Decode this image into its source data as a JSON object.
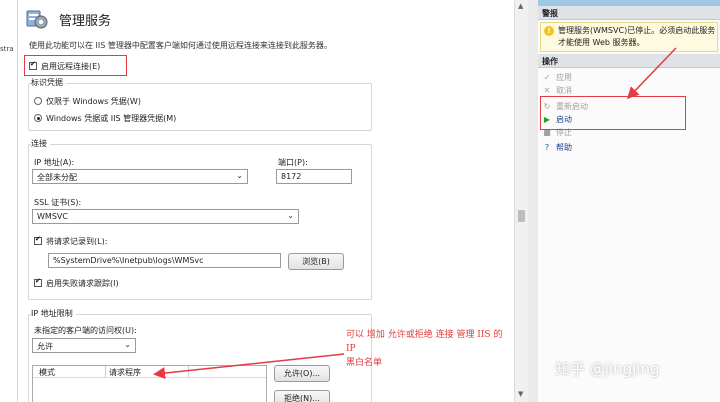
{
  "left_strip": {
    "text": "stra"
  },
  "feature": {
    "title": "管理服务",
    "description": "使用此功能可以在 IIS 管理器中配置客户端如何通过使用远程连接来连接到此服务器。"
  },
  "enable_remote": {
    "label": "启用远程连接(E)",
    "checked": true
  },
  "identity": {
    "group_title": "标识凭据",
    "options": [
      {
        "label": "仅限于 Windows 凭据(W)",
        "checked": false
      },
      {
        "label": "Windows 凭据或 IIS 管理器凭据(M)",
        "checked": true
      }
    ]
  },
  "connection": {
    "group_title": "连接",
    "ip_label": "IP 地址(A):",
    "ip_value": "全部未分配",
    "port_label": "端口(P):",
    "port_value": "8172",
    "ssl_label": "SSL 证书(S):",
    "ssl_value": "WMSVC",
    "log_label": "将请求记录到(L):",
    "log_checked": true,
    "log_path": "%SystemDrive%\\Inetpub\\logs\\WMSvc",
    "browse_label": "浏览(B)",
    "failed_label": "启用失败请求跟踪(I)",
    "failed_checked": true
  },
  "ip_restrictions": {
    "group_title": "IP 地址限制",
    "access_label": "未指定的客户端的访问权(U):",
    "access_value": "允许",
    "columns": [
      "模式",
      "请求程序"
    ],
    "allow_button": "允许(O)...",
    "deny_button": "拒绝(N)..."
  },
  "annotation": {
    "line1": "可以 增加 允许或拒绝 连接 管理 IIS 的 IP",
    "line2": "黑白名单",
    "color": "#e23a3a"
  },
  "right_panel": {
    "alerts_header": "警报",
    "alert_text": "管理服务(WMSVC)已停止。必须启动此服务才能使用 Web 服务器。",
    "actions_header": "操作",
    "actions": [
      {
        "label": "应用",
        "icon": "apply-icon",
        "enabled": false
      },
      {
        "label": "取消",
        "icon": "cancel-icon",
        "enabled": false
      },
      {
        "label": "重新启动",
        "icon": "restart-icon",
        "enabled": false
      },
      {
        "label": "启动",
        "icon": "start-icon",
        "enabled": true
      },
      {
        "label": "停止",
        "icon": "stop-icon",
        "enabled": false
      },
      {
        "label": "帮助",
        "icon": "help-icon",
        "enabled": true
      }
    ]
  },
  "watermark": "知乎 @jingjing",
  "colors": {
    "highlight": "#e43b44",
    "alert_bg": "#fefae0",
    "panel_header": "#dfe3e8"
  }
}
